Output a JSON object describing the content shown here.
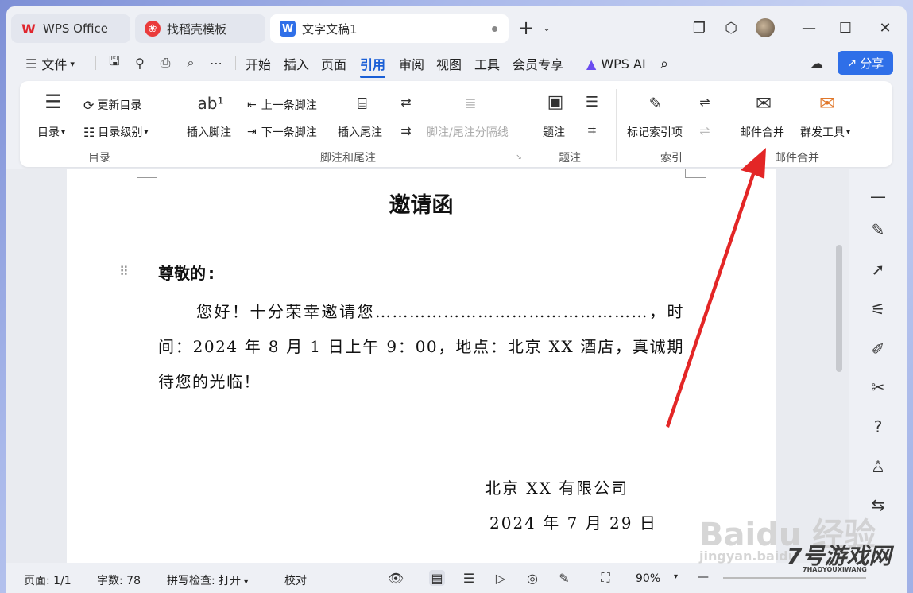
{
  "titlebar": {
    "tabs": [
      {
        "label": "WPS Office",
        "icon": "wps-logo-icon"
      },
      {
        "label": "找稻壳模板",
        "icon": "docer-icon"
      },
      {
        "label": "文字文稿1",
        "icon": "word-doc-icon",
        "active": true
      }
    ],
    "new_tab": "+"
  },
  "menubar": {
    "file_label": "文件",
    "items": [
      "开始",
      "插入",
      "页面",
      "引用",
      "审阅",
      "视图",
      "工具",
      "会员专享"
    ],
    "active": "引用",
    "wps_ai": "WPS AI",
    "share": "分享"
  },
  "ribbon": {
    "toc": {
      "label": "目录",
      "update": "更新目录",
      "level": "目录级别",
      "group": "目录"
    },
    "footnote": {
      "insert_footnote": "插入脚注",
      "prev_footnote": "上一条脚注",
      "next_footnote": "下一条脚注",
      "insert_endnote": "插入尾注",
      "separator": "脚注/尾注分隔线",
      "group": "脚注和尾注"
    },
    "caption": {
      "label": "题注",
      "group": "题注"
    },
    "index": {
      "mark": "标记索引项",
      "group": "索引"
    },
    "mail": {
      "merge": "邮件合并",
      "bulk": "群发工具",
      "group": "邮件合并"
    }
  },
  "document": {
    "title": "邀请函",
    "greeting": "尊敬的",
    "greeting_colon": ":",
    "body": "您好！十分荣幸邀请您…………………………………………，时间：2024 年 8 月 1 日上午 9：00，地点：北京 XX 酒店，真诚期待您的光临！",
    "company": "北京 XX 有限公司",
    "date": "2024 年 7 月 29 日"
  },
  "statusbar": {
    "page": "页面: 1/1",
    "words": "字数: 78",
    "spell": "拼写检查: 打开",
    "proof": "校对",
    "zoom": "90%"
  },
  "watermarks": {
    "baidu": "Baidu 经验",
    "baidu_url": "jingyan.baidu",
    "site": "7号游戏网",
    "site_sub": "7HAOYOUXIWANG"
  },
  "colors": {
    "accent": "#1a5fd6",
    "share_bg": "#2f6fe8",
    "arrow": "#e32626"
  }
}
